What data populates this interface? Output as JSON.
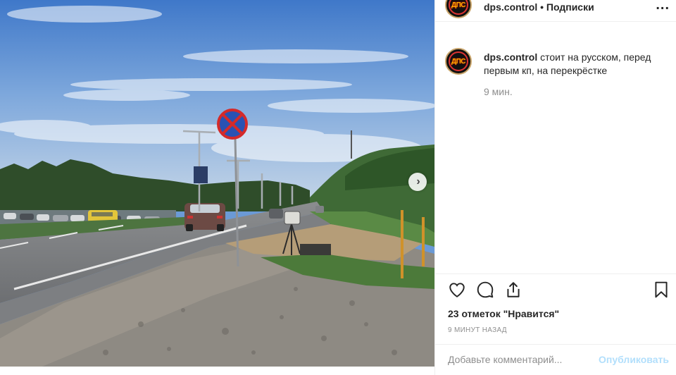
{
  "post": {
    "username": "dps.control",
    "separator": "•",
    "follow_label": "Подписки",
    "more_label": "...",
    "avatar_logo_text": "ДПС"
  },
  "caption": {
    "username": "dps.control",
    "text": "стоит на русском, перед первым кп, на перекрёстке",
    "time": "9 мин."
  },
  "actions": {
    "like_icon": "heart-icon",
    "comment_icon": "comment-icon",
    "share_icon": "share-icon",
    "save_icon": "bookmark-icon"
  },
  "likes_text": "23 отметок \"Нравится\"",
  "posted_ago": "9 МИНУТ НАЗАД",
  "comment": {
    "placeholder": "Добавьте комментарий...",
    "publish_label": "Опубликовать"
  },
  "carousel": {
    "next_icon": "chevron-right-icon",
    "next_glyph": "›"
  },
  "colors": {
    "publish_disabled": "#b2dffc",
    "secondary_text": "#8e8e8e",
    "divider": "#efefef"
  }
}
